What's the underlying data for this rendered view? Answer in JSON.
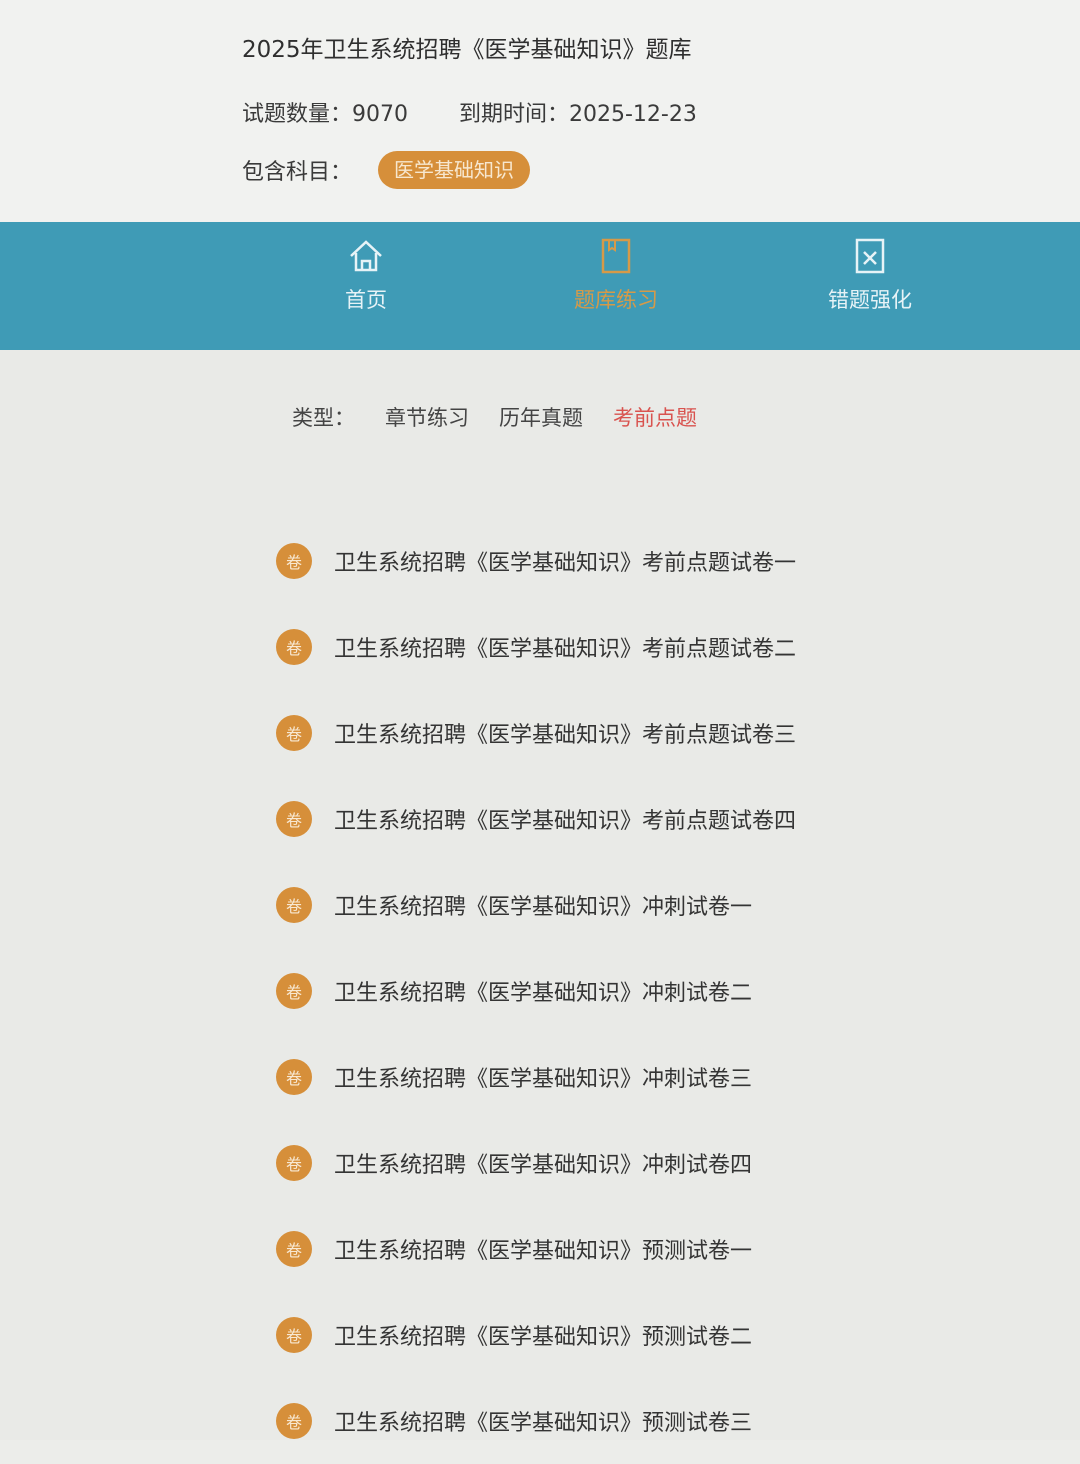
{
  "header": {
    "title": "2025年卫生系统招聘《医学基础知识》题库",
    "count_label": "试题数量：9070",
    "expire_label": "到期时间：2025-12-23",
    "subjects_label": "包含科目：",
    "subject_badge": "医学基础知识"
  },
  "nav": {
    "home": "首页",
    "bank": "题库练习",
    "wrong": "错题强化",
    "active": "bank"
  },
  "types": {
    "label": "类型：",
    "items": [
      "章节练习",
      "历年真题",
      "考前点题"
    ],
    "active_index": 2
  },
  "list": {
    "badge_char": "卷",
    "items": [
      "卫生系统招聘《医学基础知识》考前点题试卷一",
      "卫生系统招聘《医学基础知识》考前点题试卷二",
      "卫生系统招聘《医学基础知识》考前点题试卷三",
      "卫生系统招聘《医学基础知识》考前点题试卷四",
      "卫生系统招聘《医学基础知识》冲刺试卷一",
      "卫生系统招聘《医学基础知识》冲刺试卷二",
      "卫生系统招聘《医学基础知识》冲刺试卷三",
      "卫生系统招聘《医学基础知识》冲刺试卷四",
      "卫生系统招聘《医学基础知识》预测试卷一",
      "卫生系统招聘《医学基础知识》预测试卷二",
      "卫生系统招聘《医学基础知识》预测试卷三"
    ]
  },
  "colors": {
    "accent": "#d68f3a",
    "nav_bg": "#3f9bb6",
    "active_type": "#d9534f"
  }
}
